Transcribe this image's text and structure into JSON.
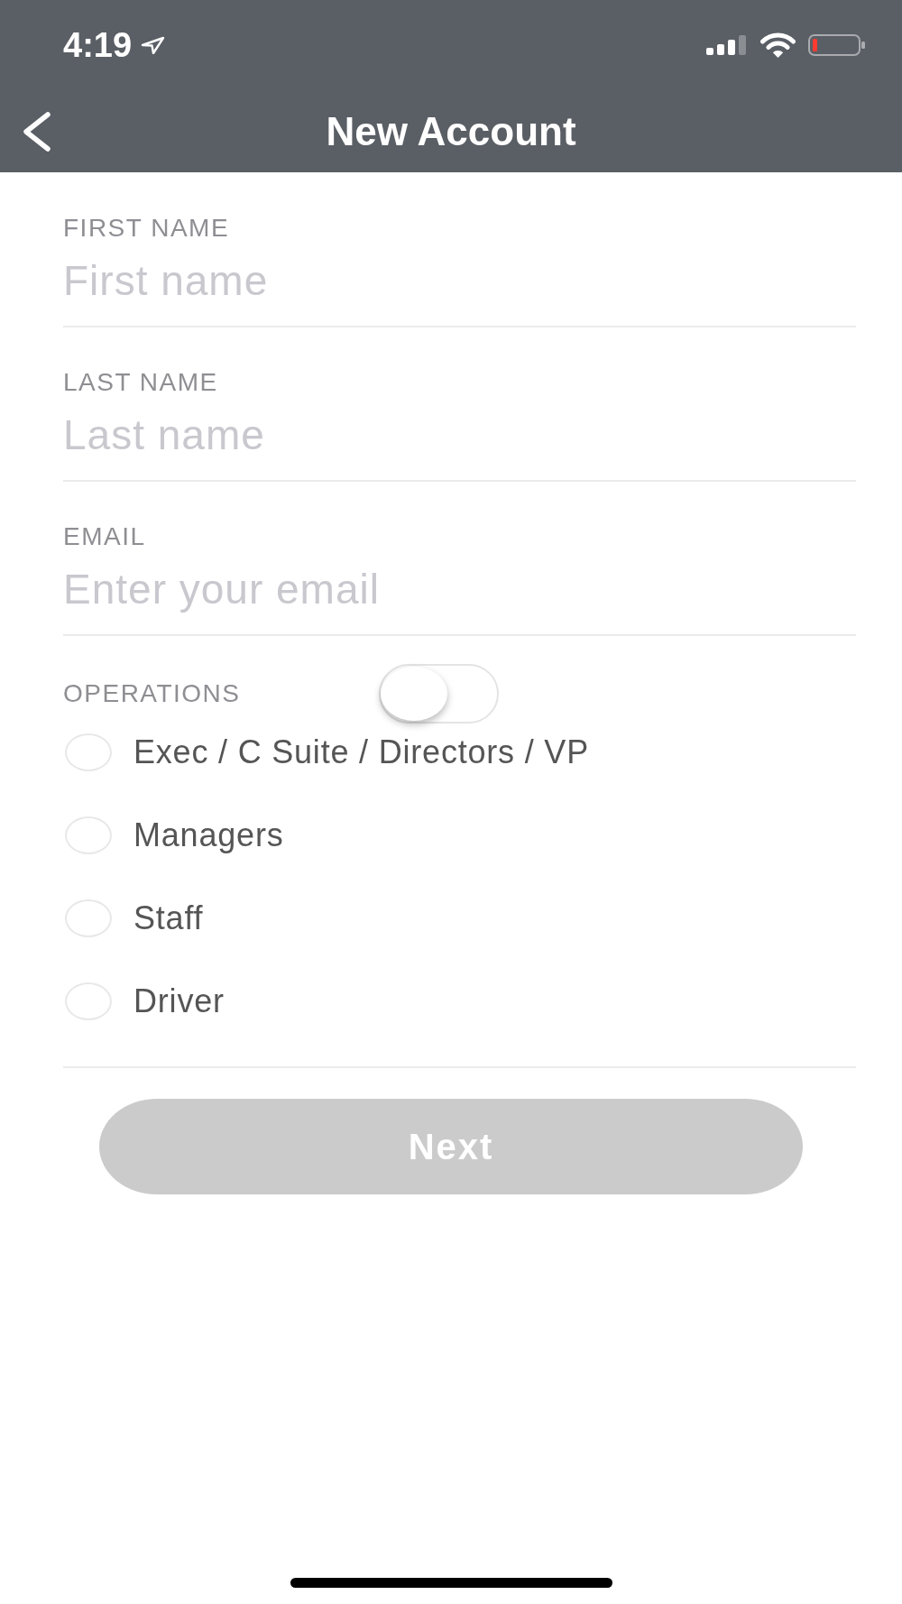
{
  "status_bar": {
    "time": "4:19"
  },
  "nav_bar": {
    "title": "New Account"
  },
  "fields": [
    {
      "label": "FIRST NAME",
      "placeholder": "First name"
    },
    {
      "label": "LAST NAME",
      "placeholder": "Last name"
    },
    {
      "label": "EMAIL",
      "placeholder": "Enter your email"
    }
  ],
  "operations": {
    "label": "OPERATIONS",
    "toggle": {
      "on": false
    },
    "options": [
      {
        "label": "Exec / C Suite / Directors / VP",
        "selected": false
      },
      {
        "label": "Managers",
        "selected": false
      },
      {
        "label": "Staff",
        "selected": false
      },
      {
        "label": "Driver",
        "selected": false
      }
    ]
  },
  "next_button": {
    "label": "Next",
    "disabled": true
  }
}
